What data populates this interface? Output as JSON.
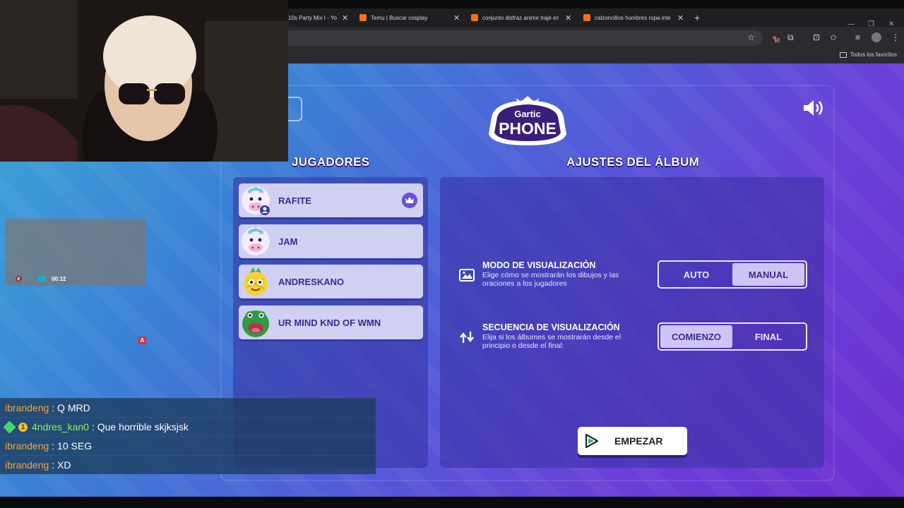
{
  "browser": {
    "tabs": [
      {
        "label": "10s Party Mix I - Yo",
        "favicon": "youtube-favicon"
      },
      {
        "label": "Temu | Buscar cosplay",
        "favicon": "temu-favicon"
      },
      {
        "label": "conjunto disfraz anime traje en",
        "favicon": "temu-favicon"
      },
      {
        "label": "calzoncillos hombres ropa inte",
        "favicon": "temu-favicon"
      }
    ],
    "new_tab": "+",
    "extension_badge": "17",
    "favorites_label": "Todos los favoritos"
  },
  "game": {
    "logo_top": "Gartic",
    "logo_bottom": "PHONE",
    "players_title": "JUGADORES",
    "settings_title": "AJUSTES DEL ÁLBUM",
    "players": [
      {
        "name": "RAFITE",
        "host": true,
        "avatar": "unicorn-avatar"
      },
      {
        "name": "JAM",
        "host": false,
        "avatar": "unicorn-avatar"
      },
      {
        "name": "ANDRESKANO",
        "host": false,
        "avatar": "pineapple-avatar"
      },
      {
        "name": "UR MIND KND OF WMN",
        "host": false,
        "avatar": "green-frog-avatar"
      }
    ],
    "settings": [
      {
        "title": "MODO DE VISUALIZACIÓN",
        "desc": "Elige cómo se mostrarán los dibujos y las oraciones a los jugadores",
        "icon": "image-icon",
        "options": [
          "AUTO",
          "MANUAL"
        ],
        "selected": "MANUAL"
      },
      {
        "title": "SECUENCIA DE VISUALIZACIÓN",
        "desc": "Elija si los álbumes se mostrarán desde el principio o desde el final:",
        "icon": "up-down-arrows-icon",
        "options": [
          "COMIENZO",
          "FINAL"
        ],
        "selected": "COMIENZO"
      }
    ],
    "start_label": "EMPEZAR"
  },
  "overlay": {
    "mini_player_time": "00:12",
    "a_badge": "A",
    "chat": [
      {
        "user": "ibrandeng",
        "msg": ": Q MRD",
        "badges": []
      },
      {
        "user": "4ndres_kan0",
        "msg": ": Que horrible skjksjsk",
        "badges": [
          "green-diamond-badge",
          "gold-badge"
        ]
      },
      {
        "user": "ibrandeng",
        "msg": ": 10 SEG",
        "badges": []
      },
      {
        "user": "ibrandeng",
        "msg": ": XD",
        "badges": []
      }
    ]
  },
  "colors": {
    "accent_purple": "#6b2fcf",
    "player_card": "#cfd0f2",
    "username_orange": "#f3a43c",
    "username_green": "#8ef05a"
  }
}
